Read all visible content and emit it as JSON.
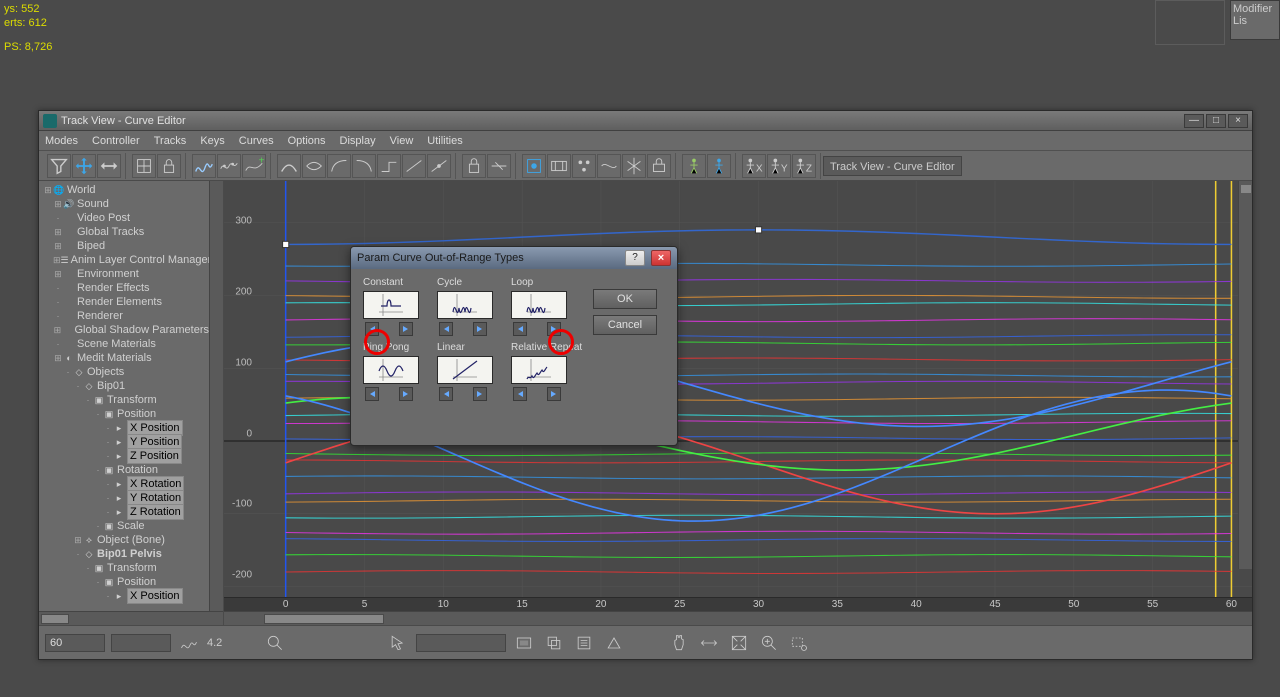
{
  "stats": {
    "line1_label": "ys:",
    "line1_val": "552",
    "line2_label": "erts:",
    "line2_val": "612",
    "fps_label": "PS:",
    "fps_val": "8,726"
  },
  "modlist": {
    "label": "Modifier Lis"
  },
  "window": {
    "title": "Track View - Curve Editor",
    "toolbar_label": "Track View - Curve Editor",
    "min": "—",
    "max": "□",
    "close": "×",
    "menus": [
      "Modes",
      "Controller",
      "Tracks",
      "Keys",
      "Curves",
      "Options",
      "Display",
      "View",
      "Utilities"
    ]
  },
  "tree": [
    {
      "d": 0,
      "t": "+",
      "i": "globe",
      "l": "World"
    },
    {
      "d": 1,
      "t": "+",
      "i": "snd",
      "l": "Sound"
    },
    {
      "d": 1,
      "t": "",
      "i": "",
      "l": "Video Post"
    },
    {
      "d": 1,
      "t": "+",
      "i": "",
      "l": "Global Tracks"
    },
    {
      "d": 1,
      "t": "+",
      "i": "",
      "l": "Biped"
    },
    {
      "d": 1,
      "t": "+",
      "i": "brk",
      "l": "Anim Layer Control Manager"
    },
    {
      "d": 1,
      "t": "+",
      "i": "",
      "l": "Environment"
    },
    {
      "d": 1,
      "t": "",
      "i": "",
      "l": "Render Effects"
    },
    {
      "d": 1,
      "t": "",
      "i": "",
      "l": "Render Elements"
    },
    {
      "d": 1,
      "t": "",
      "i": "",
      "l": "Renderer"
    },
    {
      "d": 1,
      "t": "+",
      "i": "",
      "l": "Global Shadow Parameters"
    },
    {
      "d": 1,
      "t": "",
      "i": "",
      "l": "Scene Materials"
    },
    {
      "d": 1,
      "t": "+",
      "i": "mat",
      "l": "Medit Materials"
    },
    {
      "d": 2,
      "t": "",
      "i": "obj",
      "l": "Objects"
    },
    {
      "d": 3,
      "t": "",
      "i": "obj",
      "l": "Bip01"
    },
    {
      "d": 4,
      "t": "",
      "i": "tr",
      "l": "Transform"
    },
    {
      "d": 5,
      "t": "",
      "i": "tr",
      "l": "Position"
    },
    {
      "d": 6,
      "t": "",
      "i": "key",
      "l": "X Position",
      "hl": true
    },
    {
      "d": 6,
      "t": "",
      "i": "key",
      "l": "Y Position",
      "hl": true
    },
    {
      "d": 6,
      "t": "",
      "i": "key",
      "l": "Z Position",
      "hl": true
    },
    {
      "d": 5,
      "t": "",
      "i": "tr",
      "l": "Rotation"
    },
    {
      "d": 6,
      "t": "",
      "i": "key",
      "l": "X Rotation",
      "hl": true
    },
    {
      "d": 6,
      "t": "",
      "i": "key",
      "l": "Y Rotation",
      "hl": true
    },
    {
      "d": 6,
      "t": "",
      "i": "key",
      "l": "Z Rotation",
      "hl": true
    },
    {
      "d": 5,
      "t": "",
      "i": "tr",
      "l": "Scale"
    },
    {
      "d": 3,
      "t": "+",
      "i": "bone",
      "l": "Object (Bone)"
    },
    {
      "d": 3,
      "t": "",
      "i": "obj",
      "l": "Bip01 Pelvis",
      "b": true
    },
    {
      "d": 4,
      "t": "",
      "i": "tr",
      "l": "Transform"
    },
    {
      "d": 5,
      "t": "",
      "i": "tr",
      "l": "Position"
    },
    {
      "d": 6,
      "t": "",
      "i": "key",
      "l": "X Position",
      "hl": true
    }
  ],
  "yticks": [
    300,
    200,
    100,
    0,
    -100,
    -200
  ],
  "xticks": [
    0,
    5,
    10,
    15,
    20,
    25,
    30,
    35,
    40,
    45,
    50,
    55,
    60
  ],
  "dialog": {
    "title": "Param Curve Out-of-Range Types",
    "help": "?",
    "close": "×",
    "ok": "OK",
    "cancel": "Cancel",
    "types": [
      "Constant",
      "Cycle",
      "Loop",
      "Ping Pong",
      "Linear",
      "Relative Repeat"
    ]
  },
  "bottom": {
    "field1": "60",
    "field2": "",
    "field3": "",
    "display_val": "4.2"
  }
}
